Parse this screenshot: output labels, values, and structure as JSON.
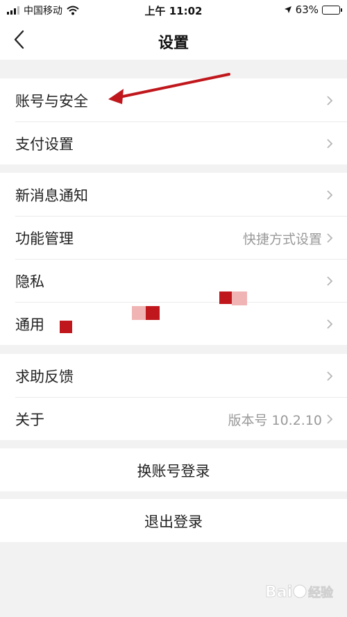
{
  "status_bar": {
    "carrier": "中国移动",
    "time": "上午 11:02",
    "battery": "63%",
    "battery_level": 0.63
  },
  "nav": {
    "title": "设置"
  },
  "groups": [
    {
      "rows": [
        {
          "label": "账号与安全"
        },
        {
          "label": "支付设置"
        }
      ]
    },
    {
      "rows": [
        {
          "label": "新消息通知"
        },
        {
          "label": "功能管理",
          "value": "快捷方式设置"
        },
        {
          "label": "隐私"
        },
        {
          "label": "通用"
        }
      ]
    },
    {
      "rows": [
        {
          "label": "求助反馈"
        },
        {
          "label": "关于",
          "value": "版本号 10.2.10"
        }
      ]
    }
  ],
  "actions": {
    "switch_account": "换账号登录",
    "logout": "退出登录"
  },
  "colors": {
    "annotation_arrow": "#c0171c",
    "background": "#f2f2f2"
  }
}
